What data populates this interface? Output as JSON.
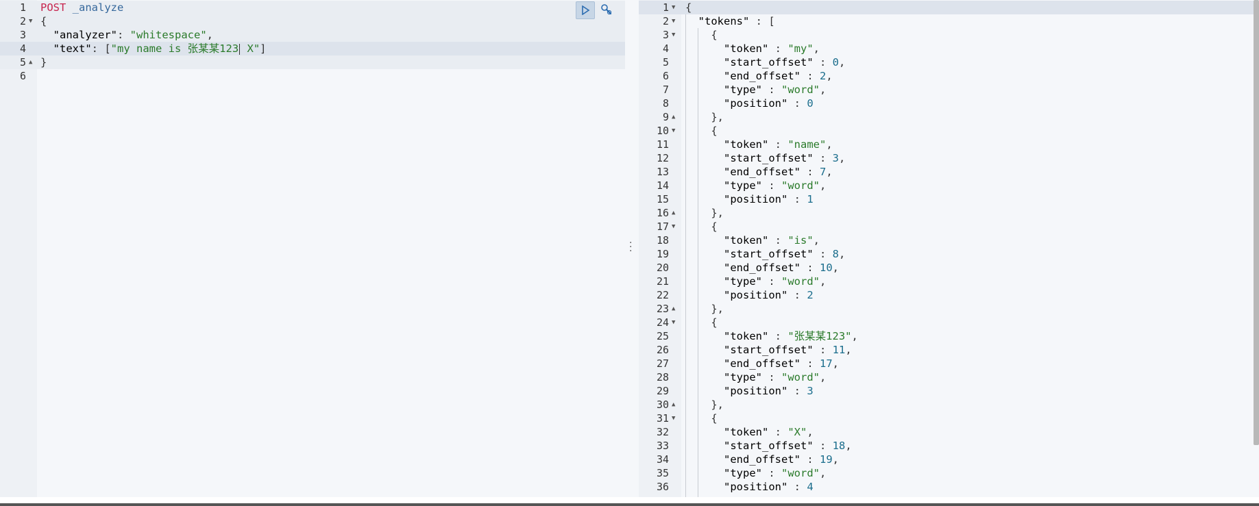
{
  "request": {
    "method": "POST",
    "endpoint": "_analyze",
    "open_brace": "{",
    "close_brace": "}",
    "analyzer_key": "\"analyzer\"",
    "analyzer_value": "\"whitespace\"",
    "text_key": "\"text\"",
    "text_value_before_cursor": "\"my name is 张某某123",
    "text_value_after_cursor": " X\"",
    "line_numbers": [
      "1",
      "2",
      "3",
      "4",
      "5",
      "6"
    ]
  },
  "toolbar": {
    "run_icon": "play-icon",
    "settings_icon": "wrench-icon"
  },
  "response": {
    "line_numbers": [
      "1",
      "2",
      "3",
      "4",
      "5",
      "6",
      "7",
      "8",
      "9",
      "10",
      "11",
      "12",
      "13",
      "14",
      "15",
      "16",
      "17",
      "18",
      "19",
      "20",
      "21",
      "22",
      "23",
      "24",
      "25",
      "26",
      "27",
      "28",
      "29",
      "30",
      "31",
      "32",
      "33",
      "34",
      "35",
      "36"
    ],
    "tokens_key": "\"tokens\"",
    "tokens": [
      {
        "token": "\"my\"",
        "start_offset": "0",
        "end_offset": "2",
        "type": "\"word\"",
        "position": "0"
      },
      {
        "token": "\"name\"",
        "start_offset": "3",
        "end_offset": "7",
        "type": "\"word\"",
        "position": "1"
      },
      {
        "token": "\"is\"",
        "start_offset": "8",
        "end_offset": "10",
        "type": "\"word\"",
        "position": "2"
      },
      {
        "token": "\"张某某123\"",
        "start_offset": "11",
        "end_offset": "17",
        "type": "\"word\"",
        "position": "3"
      },
      {
        "token": "\"X\"",
        "start_offset": "18",
        "end_offset": "19",
        "type": "\"word\"",
        "position": "4"
      }
    ],
    "labels": {
      "token": "\"token\"",
      "start_offset": "\"start_offset\"",
      "end_offset": "\"end_offset\"",
      "type": "\"type\"",
      "position": "\"position\""
    }
  },
  "colors": {
    "keyword": "#c7254e",
    "string": "#2a7a2a",
    "number": "#1a6d8c",
    "gutter": "#eef1f5",
    "active_line": "#dde3ec"
  }
}
